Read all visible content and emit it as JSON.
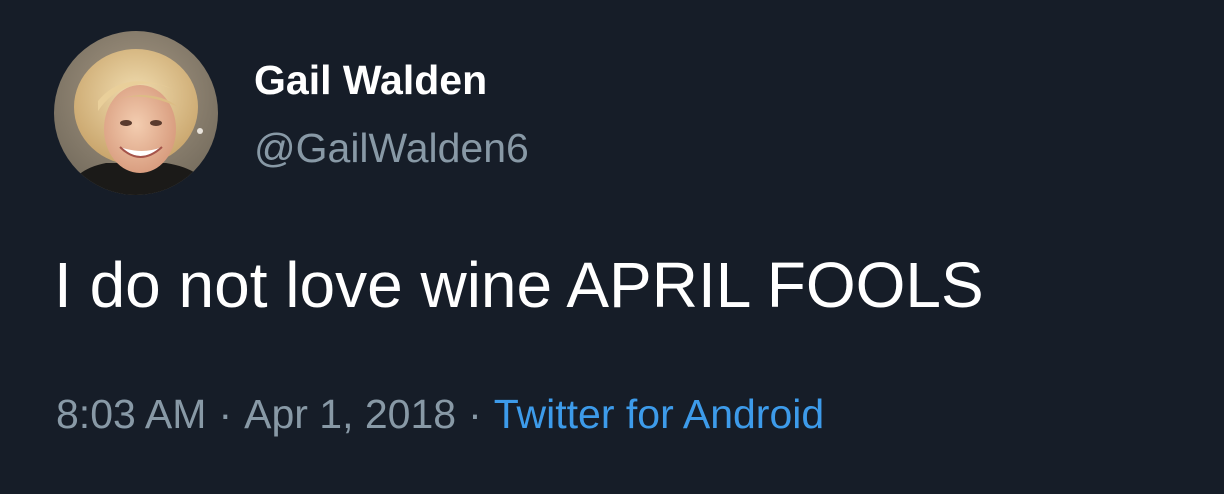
{
  "tweet": {
    "author": {
      "display_name": "Gail Walden",
      "handle": "@GailWalden6",
      "avatar_icon": "profile-photo"
    },
    "text": "I do not love wine APRIL FOOLS",
    "time": "8:03 AM",
    "date": "Apr 1, 2018",
    "separator": "·",
    "source": "Twitter for Android"
  },
  "colors": {
    "background": "#161d28",
    "primary_text": "#ffffff",
    "secondary_text": "#8899a6",
    "link": "#3d9bea"
  }
}
